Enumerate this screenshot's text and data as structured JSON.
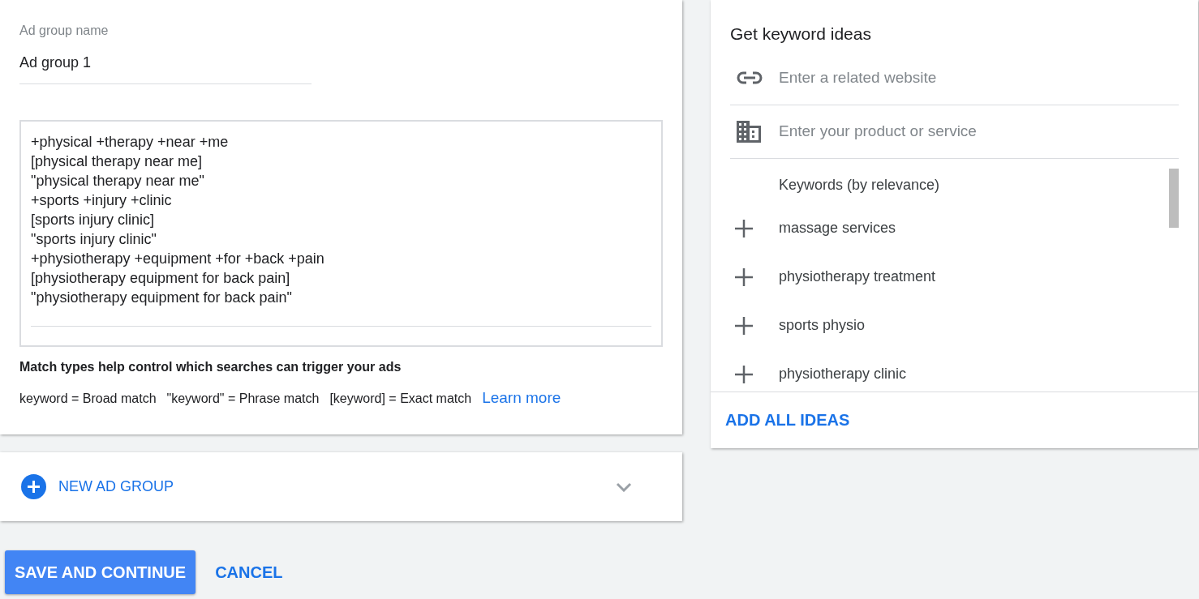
{
  "ad_group": {
    "name_label": "Ad group name",
    "name_value": "Ad group 1",
    "keywords": [
      "+physical +therapy +near +me",
      "[physical therapy near me]",
      "\"physical therapy near me\"",
      "+sports +injury +clinic",
      "[sports injury clinic]",
      "\"sports injury clinic\"",
      "+physiotherapy +equipment +for +back +pain",
      "[physiotherapy equipment for back pain]",
      "\"physiotherapy equipment for back pain\""
    ],
    "help_title": "Match types help control which searches can trigger your ads",
    "match_types": [
      "keyword = Broad match",
      "\"keyword\" = Phrase match",
      "[keyword] = Exact match"
    ],
    "learn_more": "Learn more"
  },
  "new_ad_group": {
    "label": "NEW AD GROUP",
    "expanded": false
  },
  "actions": {
    "primary": "SAVE AND CONTINUE",
    "secondary": "CANCEL"
  },
  "keyword_ideas": {
    "title": "Get keyword ideas",
    "fields": [
      {
        "kind": "website",
        "placeholder": "Enter a related website"
      },
      {
        "kind": "product",
        "placeholder": "Enter your product or service"
      }
    ],
    "list_heading": "Keywords (by relevance)",
    "ideas": [
      "massage services",
      "physiotherapy treatment",
      "sports physio",
      "physiotherapy clinic"
    ],
    "add_all": "ADD ALL IDEAS"
  }
}
